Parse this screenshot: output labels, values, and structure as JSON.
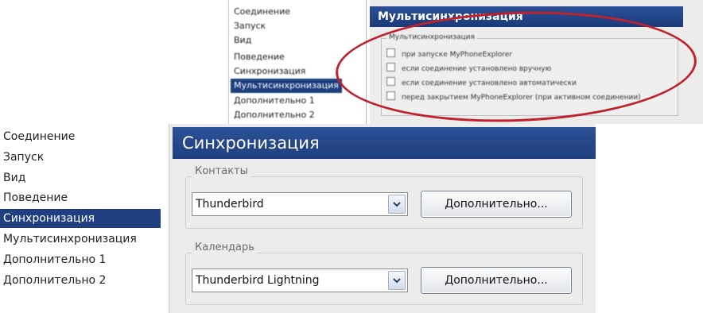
{
  "back_window": {
    "nav_items": [
      {
        "label": "Соединение",
        "selected": false
      },
      {
        "label": "Запуск",
        "selected": false
      },
      {
        "label": "Вид",
        "selected": false
      },
      {
        "label": "Поведение",
        "selected": false
      },
      {
        "label": "Синхронизация",
        "selected": false
      },
      {
        "label": "Мультисинхронизация",
        "selected": true
      },
      {
        "label": "Дополнительно 1",
        "selected": false
      },
      {
        "label": "Дополнительно 2",
        "selected": false
      }
    ],
    "header_title": "Мультисинхронизация",
    "group_caption": "Мультисинхронизация",
    "options": [
      {
        "label": "при запуске MyPhoneExplorer",
        "checked": false
      },
      {
        "label": "если соединение установлено вручную",
        "checked": false
      },
      {
        "label": "если соединение установлено автоматически",
        "checked": false
      },
      {
        "label": "перед закрытием MyPhoneExplorer (при активном соединении)",
        "checked": false
      }
    ],
    "highlight_color": "#c0222b"
  },
  "front_window": {
    "nav_items": [
      {
        "label": "Соединение",
        "selected": false
      },
      {
        "label": "Запуск",
        "selected": false
      },
      {
        "label": "Вид",
        "selected": false
      },
      {
        "label": "Поведение",
        "selected": false
      },
      {
        "label": "Синхронизация",
        "selected": true
      },
      {
        "label": "Мультисинхронизация",
        "selected": false
      },
      {
        "label": "Дополнительно 1",
        "selected": false
      },
      {
        "label": "Дополнительно 2",
        "selected": false
      }
    ],
    "header_title": "Синхронизация",
    "contacts": {
      "label": "Контакты",
      "selected_value": "Thunderbird",
      "button_label": "Дополнительно..."
    },
    "calendar": {
      "label": "Календарь",
      "selected_value": "Thunderbird Lightning",
      "button_label": "Дополнительно..."
    }
  },
  "colors": {
    "selection": "#1f3f80",
    "header": "#1f3f80",
    "panel_bg": "#ececec"
  }
}
